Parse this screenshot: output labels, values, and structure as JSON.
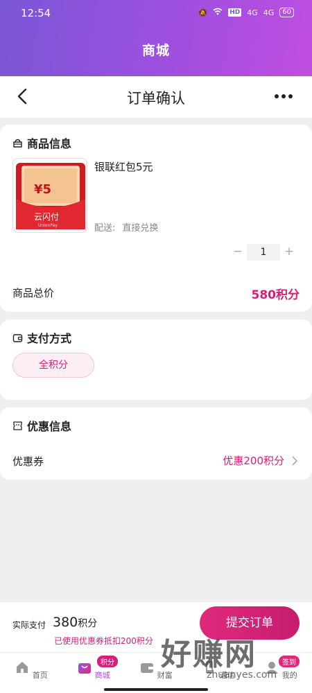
{
  "status": {
    "time": "12:54",
    "signal1": "4G",
    "signal2": "4G",
    "hd": "HD",
    "battery": "60"
  },
  "app": {
    "title": "商城"
  },
  "nav": {
    "title": "订单确认"
  },
  "product_section": {
    "title": "商品信息",
    "name": "银联红包5元",
    "thumb_amount": "¥5",
    "thumb_brand": "云闪付",
    "thumb_brand_en": "UnionPay",
    "shipping_label": "配送:",
    "shipping_value": "直接兑换",
    "qty_minus": "−",
    "qty_value": "1",
    "qty_plus": "+",
    "total_label": "商品总价",
    "total_value": "580积分"
  },
  "payment_section": {
    "title": "支付方式",
    "option": "全积分"
  },
  "discount_section": {
    "title": "优惠信息",
    "coupon_label": "优惠券",
    "coupon_value": "优惠200积分"
  },
  "footer": {
    "actual_label": "实际支付",
    "actual_amount": "380",
    "actual_unit": "积分",
    "note": "已使用优惠券抵扣200积分",
    "submit": "提交订单"
  },
  "tabbar": {
    "tabs": [
      {
        "label": "首页"
      },
      {
        "label": "商城"
      },
      {
        "label": "财富"
      },
      {
        "label": "通信"
      },
      {
        "label": "我的"
      }
    ],
    "badge_mall": "积分",
    "badge_mine": "签到"
  },
  "watermark": {
    "text": "好赚网",
    "url": "zhuanyes.com"
  },
  "colors": {
    "accent": "#d81e7b",
    "header_start": "#7a57d6",
    "header_end": "#c04ee0"
  }
}
